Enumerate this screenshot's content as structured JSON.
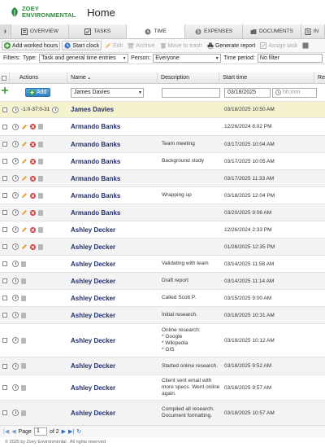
{
  "app": {
    "logo_line1": "ZOEY",
    "logo_line2": "ENVIRONMENTAL",
    "title": "Home",
    "brand_color": "#2e8b3e"
  },
  "tabs": [
    {
      "label": "OVERVIEW",
      "icon": "overview-icon",
      "active": false
    },
    {
      "label": "TASKS",
      "icon": "tasks-icon",
      "active": false
    },
    {
      "label": "TIME",
      "icon": "clock-icon",
      "active": true
    },
    {
      "label": "EXPENSES",
      "icon": "dollar-icon",
      "active": false
    },
    {
      "label": "DOCUMENTS",
      "icon": "folder-icon",
      "active": false
    },
    {
      "label": "IN",
      "icon": "invoice-icon",
      "active": false
    }
  ],
  "toolbar": {
    "add_worked_hours": "Add worked hours",
    "start_clock": "Start clock",
    "edit": "Edit",
    "archive": "Archive",
    "move_to_trash": "Move to trash",
    "generate_report": "Generate report",
    "assign_task": "Assign task"
  },
  "filters": {
    "label": "Filters:",
    "type_label": "Type:",
    "type_value": "Task and general time entries",
    "person_label": "Person:",
    "person_value": "Everyone",
    "period_label": "Time period:",
    "period_value": "No filter"
  },
  "columns": {
    "actions": "Actions",
    "name": "Name",
    "name_sort": "▲",
    "description": "Description",
    "start_time": "Start time",
    "extra": "Re"
  },
  "new_row": {
    "add_label": "Add",
    "name_value": "James Davies",
    "description_value": "",
    "date_value": "03/18/2025",
    "time_placeholder": "hh:mm"
  },
  "rows": [
    {
      "type": "timer",
      "timer": "-1:0-37:0-31",
      "name": "James Davies",
      "description": "",
      "start": "03/18/2025 10:50 AM"
    },
    {
      "type": "full",
      "name": "Armando Banks",
      "description": "",
      "start": "12/26/2024 8:02 PM"
    },
    {
      "type": "full",
      "name": "Armando Banks",
      "description": "Team meeting",
      "start": "03/17/2025 10:04 AM"
    },
    {
      "type": "full",
      "name": "Armando Banks",
      "description": "Background study",
      "start": "03/17/2025 10:05 AM"
    },
    {
      "type": "full",
      "name": "Armando Banks",
      "description": "",
      "start": "03/17/2025 11:33 AM"
    },
    {
      "type": "full",
      "name": "Armando Banks",
      "description": "Wrapping up",
      "start": "03/18/2025 12:04 PM"
    },
    {
      "type": "full",
      "name": "Armando Banks",
      "description": "",
      "start": "03/20/2025 9:06 AM"
    },
    {
      "type": "full",
      "name": "Ashley Decker",
      "description": "",
      "start": "12/26/2024 2:33 PM"
    },
    {
      "type": "full",
      "name": "Ashley Decker",
      "description": "",
      "start": "01/26/2025 12:35 PM"
    },
    {
      "type": "limited",
      "name": "Ashley Decker",
      "description": "Validating with team",
      "start": "03/14/2025 11:58 AM"
    },
    {
      "type": "limited",
      "name": "Ashley Decker",
      "description": "Draft report",
      "start": "03/14/2025 11:14 AM"
    },
    {
      "type": "limited",
      "name": "Ashley Decker",
      "description": "Called Scott P.",
      "start": "03/15/2025 9:00 AM"
    },
    {
      "type": "limited",
      "name": "Ashley Decker",
      "description": "Initial research.",
      "start": "03/18/2025 10:31 AM"
    },
    {
      "type": "limited",
      "name": "Ashley Decker",
      "description": "Online research:\n * Google\n * Wikipedia\n * GIS",
      "start": "03/18/2025 10:12 AM"
    },
    {
      "type": "limited",
      "name": "Ashley Decker",
      "description": "Started online research.",
      "start": "03/18/2025 9:52 AM"
    },
    {
      "type": "limited",
      "name": "Ashley Decker",
      "description": "Client sent email with more specs. Went online again.",
      "start": "03/18/2025 9:57 AM"
    },
    {
      "type": "limited",
      "name": "Ashley Decker",
      "description": "Compiled all research. Document formatting.",
      "start": "03/18/2025 10:57 AM"
    }
  ],
  "pager": {
    "page_label": "Page",
    "page_value": "1",
    "of_label": "of 2"
  },
  "footer": "© 2025 by Zoey Environmental . All rights reserved"
}
